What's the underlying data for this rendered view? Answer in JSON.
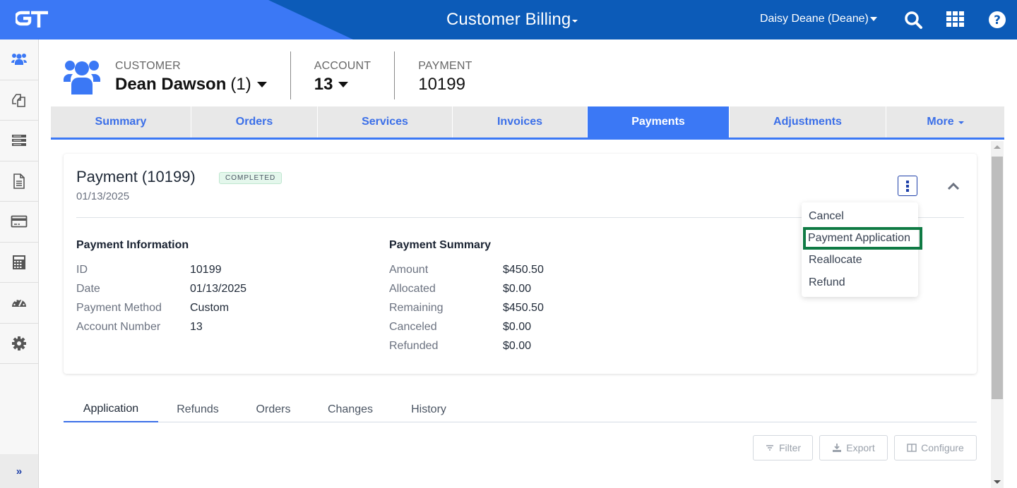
{
  "topbar": {
    "logo_text": "GT",
    "app_title": "Customer Billing",
    "user_name": "Daisy Deane (Deane)",
    "icons": [
      "search-icon",
      "apps-grid-icon",
      "help-icon"
    ]
  },
  "rail": {
    "items": [
      {
        "name": "customers",
        "icon": "users-icon",
        "active": true
      },
      {
        "name": "documents",
        "icon": "copy-icon"
      },
      {
        "name": "services",
        "icon": "server-list-icon"
      },
      {
        "name": "invoices",
        "icon": "file-text-icon"
      },
      {
        "name": "payments",
        "icon": "credit-card-icon"
      },
      {
        "name": "calculator",
        "icon": "calculator-icon"
      },
      {
        "name": "dashboard",
        "icon": "gauge-icon"
      },
      {
        "name": "settings",
        "icon": "gear-icon"
      }
    ],
    "expand_label": "»"
  },
  "context": {
    "customer_label": "CUSTOMER",
    "customer_name": "Dean Dawson",
    "customer_id": "(1)",
    "account_label": "ACCOUNT",
    "account_value": "13",
    "payment_label": "PAYMENT",
    "payment_value": "10199"
  },
  "tabs": [
    {
      "label": "Summary"
    },
    {
      "label": "Orders"
    },
    {
      "label": "Services"
    },
    {
      "label": "Invoices"
    },
    {
      "label": "Payments",
      "active": true
    },
    {
      "label": "Adjustments"
    },
    {
      "label": "More"
    }
  ],
  "payment": {
    "title": "Payment (10199)",
    "status": "COMPLETED",
    "date": "01/13/2025",
    "colors": {
      "status_bg": "#e4f7ec",
      "accent": "#3b78f5"
    }
  },
  "payment_information": {
    "heading": "Payment Information",
    "rows": [
      {
        "label": "ID",
        "value": "10199"
      },
      {
        "label": "Date",
        "value": "01/13/2025"
      },
      {
        "label": "Payment Method",
        "value": "Custom"
      },
      {
        "label": "Account Number",
        "value": "13"
      }
    ]
  },
  "payment_summary": {
    "heading": "Payment Summary",
    "rows": [
      {
        "label": "Amount",
        "value": "$450.50"
      },
      {
        "label": "Allocated",
        "value": "$0.00"
      },
      {
        "label": "Remaining",
        "value": "$450.50"
      },
      {
        "label": "Canceled",
        "value": "$0.00"
      },
      {
        "label": "Refunded",
        "value": "$0.00"
      }
    ]
  },
  "actions_menu": {
    "items": [
      {
        "label": "Cancel"
      },
      {
        "label": "Payment Application",
        "highlighted": true
      },
      {
        "label": "Reallocate"
      },
      {
        "label": "Refund"
      }
    ],
    "highlight_color": "#0f7a44"
  },
  "subtabs": [
    {
      "label": "Application",
      "active": true
    },
    {
      "label": "Refunds"
    },
    {
      "label": "Orders"
    },
    {
      "label": "Changes"
    },
    {
      "label": "History"
    }
  ],
  "toolbar": {
    "filter_label": "Filter",
    "export_label": "Export",
    "configure_label": "Configure"
  }
}
